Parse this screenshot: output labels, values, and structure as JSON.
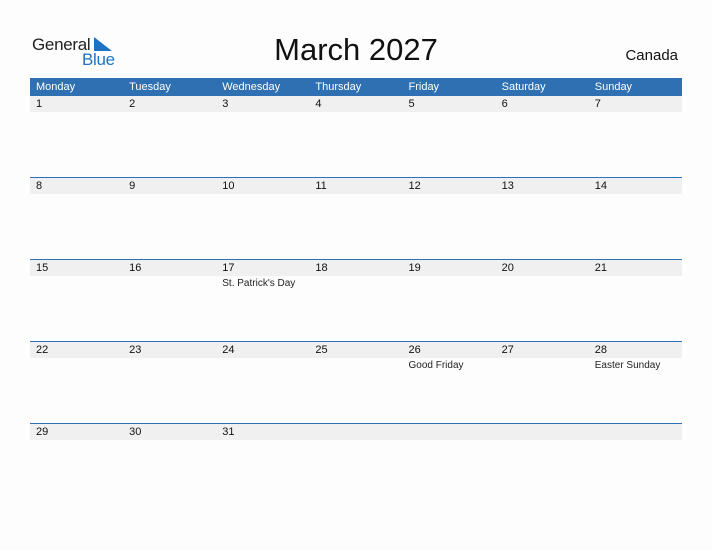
{
  "logo": {
    "line1": "General",
    "line2": "Blue"
  },
  "title": "March 2027",
  "country": "Canada",
  "colors": {
    "header": "#2e70b2",
    "band": "#f0f0f0",
    "logo_blue": "#1f73c4"
  },
  "weekdays": [
    "Monday",
    "Tuesday",
    "Wednesday",
    "Thursday",
    "Friday",
    "Saturday",
    "Sunday"
  ],
  "weeks": [
    [
      {
        "day": "1",
        "holiday": ""
      },
      {
        "day": "2",
        "holiday": ""
      },
      {
        "day": "3",
        "holiday": ""
      },
      {
        "day": "4",
        "holiday": ""
      },
      {
        "day": "5",
        "holiday": ""
      },
      {
        "day": "6",
        "holiday": ""
      },
      {
        "day": "7",
        "holiday": ""
      }
    ],
    [
      {
        "day": "8",
        "holiday": ""
      },
      {
        "day": "9",
        "holiday": ""
      },
      {
        "day": "10",
        "holiday": ""
      },
      {
        "day": "11",
        "holiday": ""
      },
      {
        "day": "12",
        "holiday": ""
      },
      {
        "day": "13",
        "holiday": ""
      },
      {
        "day": "14",
        "holiday": ""
      }
    ],
    [
      {
        "day": "15",
        "holiday": ""
      },
      {
        "day": "16",
        "holiday": ""
      },
      {
        "day": "17",
        "holiday": "St. Patrick's Day"
      },
      {
        "day": "18",
        "holiday": ""
      },
      {
        "day": "19",
        "holiday": ""
      },
      {
        "day": "20",
        "holiday": ""
      },
      {
        "day": "21",
        "holiday": ""
      }
    ],
    [
      {
        "day": "22",
        "holiday": ""
      },
      {
        "day": "23",
        "holiday": ""
      },
      {
        "day": "24",
        "holiday": ""
      },
      {
        "day": "25",
        "holiday": ""
      },
      {
        "day": "26",
        "holiday": "Good Friday"
      },
      {
        "day": "27",
        "holiday": ""
      },
      {
        "day": "28",
        "holiday": "Easter Sunday"
      }
    ],
    [
      {
        "day": "29",
        "holiday": ""
      },
      {
        "day": "30",
        "holiday": ""
      },
      {
        "day": "31",
        "holiday": ""
      },
      {
        "day": "",
        "holiday": ""
      },
      {
        "day": "",
        "holiday": ""
      },
      {
        "day": "",
        "holiday": ""
      },
      {
        "day": "",
        "holiday": ""
      }
    ]
  ]
}
